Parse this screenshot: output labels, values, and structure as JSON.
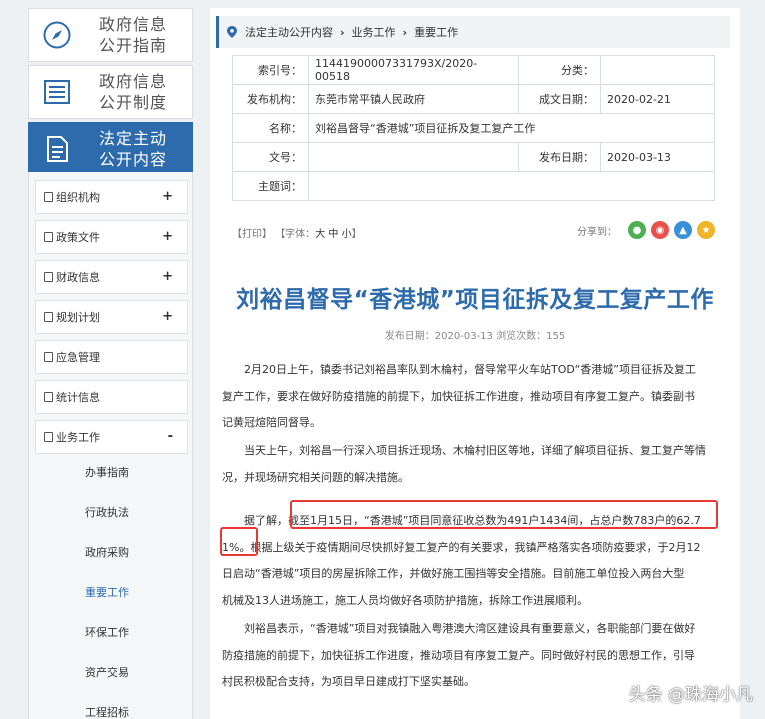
{
  "sidebar": {
    "nav": [
      {
        "line1": "政府信息",
        "line2": "公开指南",
        "icon": "compass-icon"
      },
      {
        "line1": "政府信息",
        "line2": "公开制度",
        "icon": "list-icon"
      },
      {
        "line1": "法定主动",
        "line2": "公开内容",
        "icon": "document-icon"
      }
    ],
    "menu": [
      {
        "label": "组织机构",
        "toggle": "+"
      },
      {
        "label": "政策文件",
        "toggle": "+"
      },
      {
        "label": "财政信息",
        "toggle": "+"
      },
      {
        "label": "规划计划",
        "toggle": "+"
      },
      {
        "label": "应急管理",
        "toggle": ""
      },
      {
        "label": "统计信息",
        "toggle": ""
      },
      {
        "label": "业务工作",
        "toggle": "-"
      }
    ],
    "subitems": [
      "办事指南",
      "行政执法",
      "政府采购",
      "重要工作",
      "环保工作",
      "资产交易",
      "工程招标"
    ]
  },
  "breadcrumb": [
    "法定主动公开内容",
    "业务工作",
    "重要工作"
  ],
  "meta": {
    "index_label": "索引号：",
    "index_value": "11441900007331793X/2020-00518",
    "category_label": "分类：",
    "category_value": "",
    "publisher_label": "发布机构：",
    "publisher_value": "东莞市常平镇人民政府",
    "created_label": "成文日期：",
    "created_value": "2020-02-21",
    "name_label": "名称：",
    "name_value": "刘裕昌督导“香港城”项目征拆及复工复产工作",
    "docno_label": "文号：",
    "docno_value": "",
    "pubdate_label": "发布日期：",
    "pubdate_value": "2020-03-13",
    "keywords_label": "主题词：",
    "keywords_value": ""
  },
  "tools": {
    "print": "【打印】",
    "font_prefix": "【字体：",
    "font_large": "大",
    "font_mid": "中",
    "font_small": "小",
    "font_suffix": "】",
    "share": "分享到："
  },
  "article": {
    "title": "刘裕昌督导“香港城”项目征拆及复工复产工作",
    "pubinfo": "发布日期：2020-03-13   浏览次数：155",
    "p1": [
      "2月20日上午，镇委书记刘裕昌率队到木棆村，督导常平火车站TOD“香港城”项目征拆及复工",
      "复产工作，要求在做好防疫措施的前提下，加快征拆工作进度，推动项目有序复工复产。镇委副书",
      "记黄冠煊陪同督导。"
    ],
    "p2": [
      "当天上午，刘裕昌一行深入项目拆迁现场、木棆村旧区等地，详细了解项目征拆、复工复产等情",
      "况，并现场研究相关问题的解决措施。"
    ],
    "p3": [
      "据了解，截至1月15日，“香港城”项目同意征收总数为491户1434间，占总户数783户的62.7",
      "1%。根据上级关于疫情期间尽快抓好复工复产的有关要求，我镇严格落实各项防疫要求，于2月12",
      "日启动“香港城”项目的房屋拆除工作，并做好施工围挡等安全措施。目前施工单位投入两台大型",
      "机械及13人进场施工，施工人员均做好各项防护措施，拆除工作进展顺利。"
    ],
    "p4": [
      "刘裕昌表示，“香港城”项目对我镇融入粤港澳大湾区建设具有重要意义，各职能部门要在做好",
      "防疫措施的前提下，加快征拆工作进度，推动项目有序复工复产。同时做好村民的思想工作，引导",
      "村民积极配合支持，为项目早日建成打下坚实基础。"
    ]
  },
  "watermark": "头条 @珠海小凡",
  "colors": {
    "accent": "#2e6bad",
    "highlight": "#e53935"
  }
}
